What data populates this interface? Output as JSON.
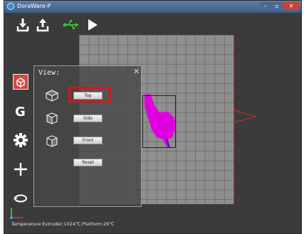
{
  "window": {
    "title": "DoraWare-P"
  },
  "view_panel": {
    "title": "View:",
    "close_symbol": "✕",
    "buttons": [
      {
        "label": "Top",
        "highlighted": true
      },
      {
        "label": "Side"
      },
      {
        "label": "Front"
      },
      {
        "label": "Reset"
      }
    ]
  },
  "status": {
    "text": "Temperature:Extruder:1024℃;Platform:26℃"
  },
  "toolbar": {
    "icons": [
      "import-download-icon",
      "export-upload-icon",
      "usb-icon",
      "play-icon"
    ]
  },
  "sidebar": {
    "icons": [
      "cube-view-icon",
      "gcode-g-icon",
      "settings-gear-icon",
      "move-cross-icon",
      "rotate-icon"
    ]
  },
  "colors": {
    "model": "#e000e0",
    "highlight": "#d8141c",
    "usb": "#35c235",
    "active_tool": "#d9463e",
    "platform_edge": "#d22b2b"
  }
}
